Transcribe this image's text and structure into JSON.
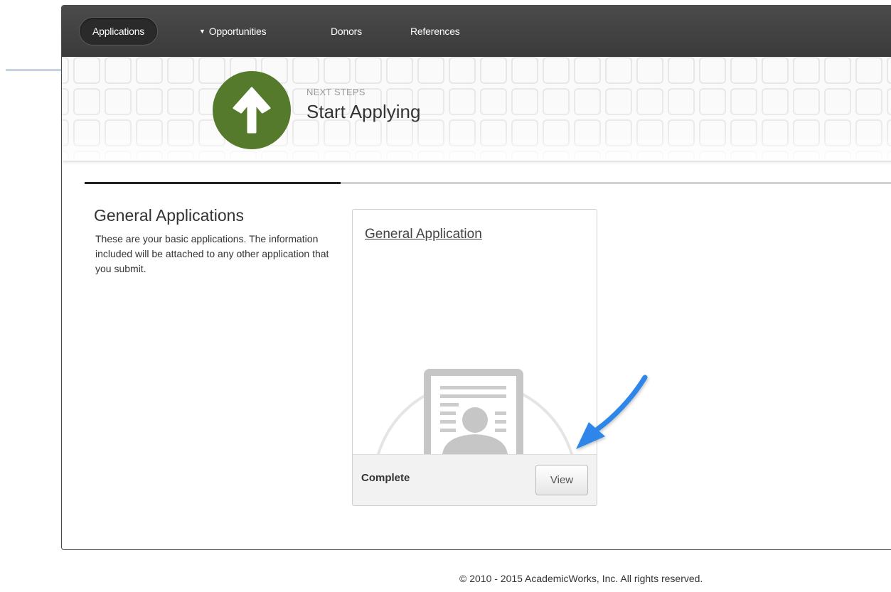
{
  "nav": {
    "items": [
      {
        "label": "Applications"
      },
      {
        "label": "Opportunities"
      },
      {
        "label": "Donors"
      },
      {
        "label": "References"
      }
    ],
    "caret": "▼"
  },
  "banner": {
    "step_label": "NEXT STEPS",
    "step_title": "Start Applying",
    "step_icon": "up-arrow-icon",
    "step_color": "#557a2b"
  },
  "section": {
    "title": "General Applications",
    "description": "These are your basic applications. The information included will be attached to any other application that you submit."
  },
  "card": {
    "title": "General Application",
    "illustration_icon": "id-card-icon",
    "status": "Complete",
    "view_label": "View"
  },
  "annotation": {
    "icon": "pointer-arrow-icon",
    "color": "#2f86e8"
  },
  "footer": {
    "copyright": "© 2010 - 2015 AcademicWorks, Inc. All rights reserved."
  }
}
